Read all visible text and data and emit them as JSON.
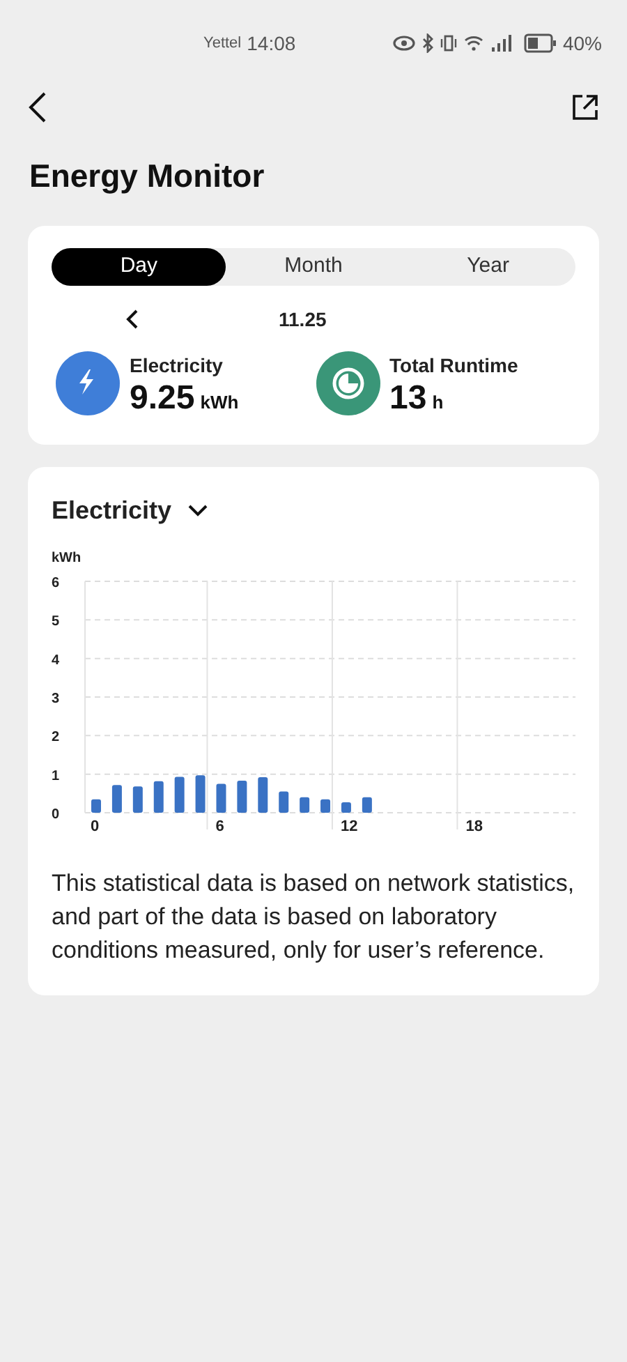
{
  "status_bar": {
    "carrier": "Yettel",
    "time": "14:08",
    "battery": "40%"
  },
  "title": "Energy Monitor",
  "tabs": [
    {
      "label": "Day",
      "selected": true
    },
    {
      "label": "Month",
      "selected": false
    },
    {
      "label": "Year",
      "selected": false
    }
  ],
  "date": "11.25",
  "stats": [
    {
      "kind": "electricity",
      "label": "Electricity",
      "value": "9.25",
      "unit": "kWh"
    },
    {
      "kind": "runtime",
      "label": "Total Runtime",
      "value": "13",
      "unit": "h"
    }
  ],
  "chart_card": {
    "selector": "Electricity",
    "chart_data": {
      "type": "bar",
      "ylabel": "kWh",
      "ylim": [
        0,
        6
      ],
      "yticks": [
        0,
        1,
        2,
        3,
        4,
        5,
        6
      ],
      "xlim": [
        0,
        23
      ],
      "xticks": [
        0,
        6,
        12,
        18
      ],
      "grid": true,
      "x": [
        0,
        1,
        2,
        3,
        4,
        5,
        6,
        7,
        8,
        9,
        10,
        11,
        12,
        13
      ],
      "series": [
        {
          "color": "#3a72c4",
          "values": [
            0.35,
            0.72,
            0.68,
            0.82,
            0.93,
            0.97,
            0.75,
            0.83,
            0.92,
            0.55,
            0.4,
            0.35,
            0.27,
            0.4
          ]
        }
      ]
    },
    "note": "This statistical data is based on network statistics, and part of the data is based on laboratory conditions measured, only for user’s reference."
  }
}
